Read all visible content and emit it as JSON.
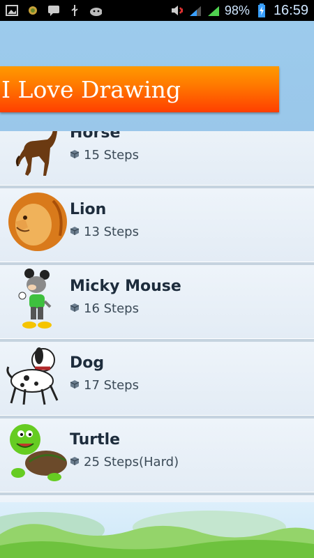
{
  "status": {
    "battery_pct": "98%",
    "time": "16:59",
    "icons": [
      "image-icon",
      "notification-icon",
      "chat-icon",
      "usb-icon",
      "android-icon",
      "mute-icon",
      "signal-icon",
      "signal-icon",
      "battery-icon"
    ]
  },
  "header": {
    "title": "I Love Drawing"
  },
  "list": {
    "items": [
      {
        "name": "Horse",
        "steps": "15 Steps",
        "thumb": "horse-icon"
      },
      {
        "name": "Lion",
        "steps": "13 Steps",
        "thumb": "lion-icon"
      },
      {
        "name": "Micky Mouse",
        "steps": "16 Steps",
        "thumb": "micky-mouse-icon"
      },
      {
        "name": "Dog",
        "steps": "17 Steps",
        "thumb": "dog-icon"
      },
      {
        "name": "Turtle",
        "steps": "25 Steps(Hard)",
        "thumb": "turtle-icon"
      }
    ]
  },
  "colors": {
    "banner": "#ff6a00",
    "sky": "#9cc8ea"
  }
}
